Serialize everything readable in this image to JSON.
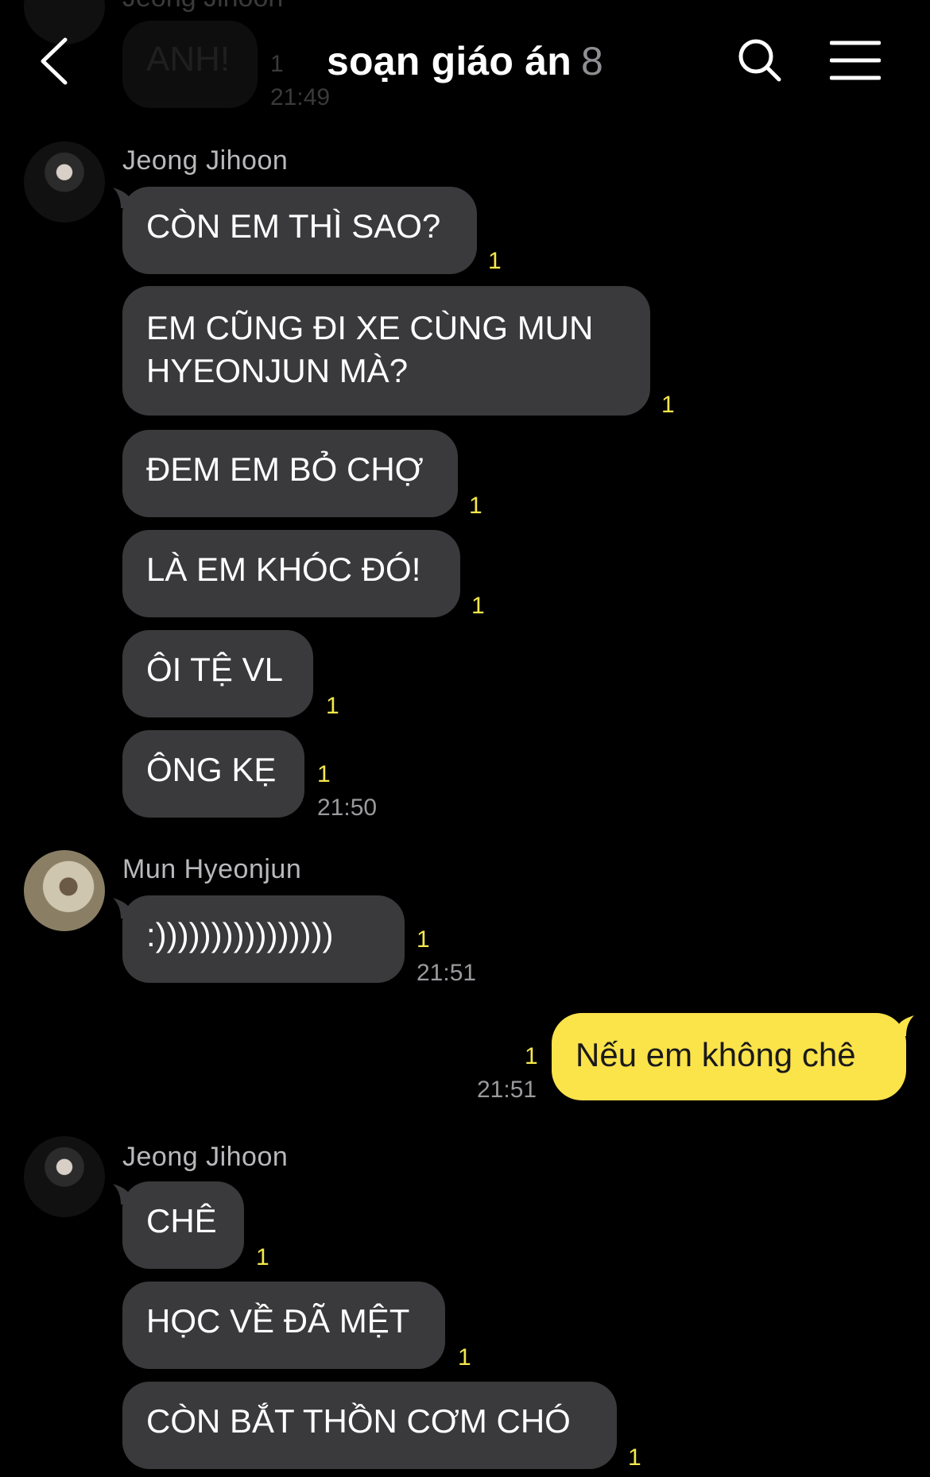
{
  "header": {
    "title": "soạn giáo án",
    "member_count": "8",
    "back_icon": "chevron-left-icon",
    "search_icon": "search-icon",
    "menu_icon": "hamburger-menu-icon"
  },
  "faded_top": {
    "sender": "Jeong Jihoon",
    "message": "ANH!",
    "unread": "1",
    "time": "21:49"
  },
  "groups": [
    {
      "sender": "Jeong Jihoon",
      "messages": [
        {
          "text": "CÒN EM THÌ SAO?",
          "unread": "1"
        },
        {
          "text": "EM CŨNG ĐI XE CÙNG MUN HYEONJUN MÀ?",
          "unread": "1"
        },
        {
          "text": "ĐEM EM BỎ CHỢ",
          "unread": "1"
        },
        {
          "text": "LÀ EM KHÓC ĐÓ!",
          "unread": "1"
        },
        {
          "text": "ÔI TỆ VL",
          "unread": "1"
        },
        {
          "text": "ÔNG KẸ",
          "unread": "1",
          "time": "21:50"
        }
      ]
    },
    {
      "sender": "Mun Hyeonjun",
      "messages": [
        {
          "text": ":))))))))))))))))",
          "unread": "1",
          "time": "21:51"
        }
      ]
    },
    {
      "sender": "me",
      "messages": [
        {
          "text": "Nếu em không chê",
          "unread": "1",
          "time": "21:51"
        }
      ]
    },
    {
      "sender": "Jeong Jihoon",
      "messages": [
        {
          "text": "CHÊ",
          "unread": "1"
        },
        {
          "text": "HỌC VỀ ĐÃ MỆT",
          "unread": "1"
        },
        {
          "text": "CÒN BẮT THỒN CƠM CHÓ",
          "unread": "1"
        }
      ]
    }
  ],
  "colors": {
    "background": "#000000",
    "incoming_bubble": "#3a3a3c",
    "outgoing_bubble": "#fbe34a",
    "unread": "#f5e84b"
  }
}
